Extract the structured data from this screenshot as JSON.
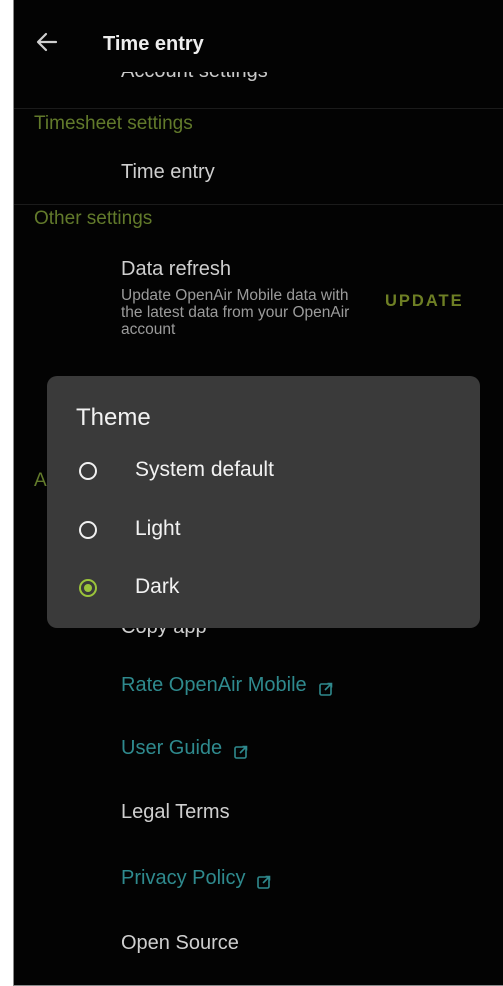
{
  "app_bar": {
    "back_icon": "arrow-left-icon",
    "title": "Time entry"
  },
  "settings": {
    "account_settings_partial": "Account settings",
    "timesheet_header": "Timesheet settings",
    "time_entry_label": "Time entry",
    "other_header": "Other settings",
    "data_refresh": {
      "title": "Data refresh",
      "description": "Update OpenAir Mobile data with the latest data from your OpenAir account",
      "action": "UPDATE"
    },
    "about_header_partial": "A",
    "copy_app_partial": "Copy app",
    "rate_label": "Rate OpenAir Mobile",
    "user_guide_label": "User Guide",
    "legal_terms_label": "Legal Terms",
    "privacy_policy_label": "Privacy Policy",
    "open_source_label": "Open Source",
    "link_icon": "open-in-new-icon"
  },
  "theme_dialog": {
    "title": "Theme",
    "options": [
      {
        "label": "System default",
        "selected": false
      },
      {
        "label": "Light",
        "selected": false
      },
      {
        "label": "Dark",
        "selected": true
      }
    ]
  },
  "colors": {
    "background": "#030303",
    "accent": "#9bc43a",
    "section_header": "#627a2b",
    "link": "#2f8a8e",
    "dialog_background": "#3a3a3a"
  }
}
